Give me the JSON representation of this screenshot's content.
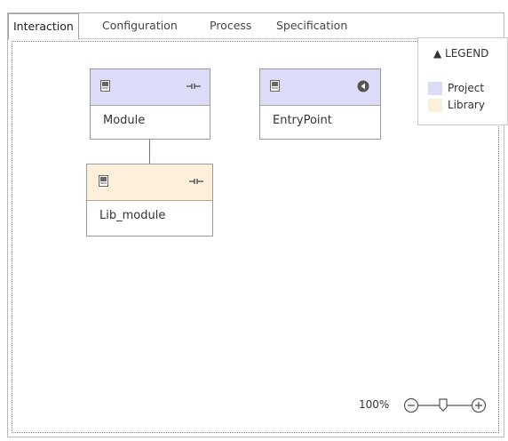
{
  "tabs": [
    {
      "label": "Interaction",
      "active": true
    },
    {
      "label": "Configuration",
      "active": false
    },
    {
      "label": "Process",
      "active": false
    },
    {
      "label": "Specification",
      "active": false
    }
  ],
  "nodes": {
    "module": {
      "label": "Module",
      "kind": "Project",
      "icons": [
        "document-icon",
        "port-icon"
      ]
    },
    "entrypoint": {
      "label": "EntryPoint",
      "kind": "Project",
      "icons": [
        "document-icon",
        "entry-point-icon"
      ]
    },
    "lib_module": {
      "label": "Lib_module",
      "kind": "Library",
      "icons": [
        "document-icon",
        "port-icon"
      ]
    }
  },
  "legend": {
    "title": "▲ LEGEND",
    "items": [
      {
        "label": "Project",
        "color": "#dcdcf8"
      },
      {
        "label": "Library",
        "color": "#fdf0da"
      }
    ]
  },
  "zoom": {
    "level": "100%",
    "minus": "zoom-out",
    "plus": "zoom-in"
  },
  "colors": {
    "project": "#dcdcf8",
    "library": "#fdf0da",
    "border": "#9a9a9a"
  }
}
